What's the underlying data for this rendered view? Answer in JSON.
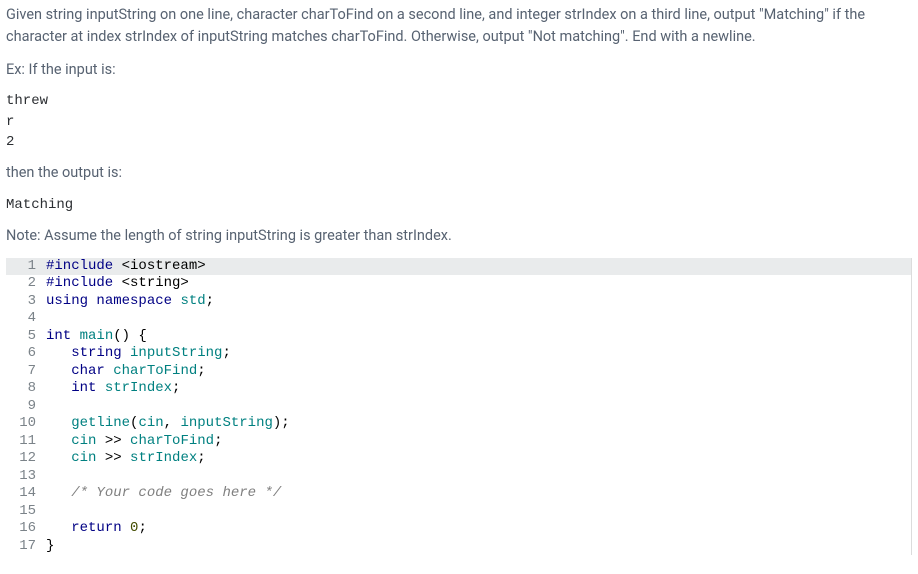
{
  "problem": {
    "description": "Given string inputString on one line, character charToFind on a second line, and integer strIndex on a third line, output \"Matching\" if the character at index strIndex of inputString matches charToFind. Otherwise, output \"Not matching\". End with a newline.",
    "example_intro": "Ex: If the input is:",
    "example_input_line1": "threw",
    "example_input_line2": "r",
    "example_input_line3": "2",
    "example_then": "then the output is:",
    "example_output": "Matching",
    "note": "Note: Assume the length of string inputString is greater than strIndex."
  },
  "code": {
    "lines": [
      {
        "n": 1,
        "tokens": [
          {
            "t": "#include ",
            "c": "kw"
          },
          {
            "t": "<iostream>",
            "c": "plain"
          }
        ],
        "current": true
      },
      {
        "n": 2,
        "tokens": [
          {
            "t": "#include ",
            "c": "kw"
          },
          {
            "t": "<string>",
            "c": "plain"
          }
        ]
      },
      {
        "n": 3,
        "tokens": [
          {
            "t": "using ",
            "c": "kw"
          },
          {
            "t": "namespace ",
            "c": "kw"
          },
          {
            "t": "std",
            "c": "ns"
          },
          {
            "t": ";",
            "c": "plain"
          }
        ]
      },
      {
        "n": 4,
        "tokens": []
      },
      {
        "n": 5,
        "tokens": [
          {
            "t": "int ",
            "c": "type"
          },
          {
            "t": "main",
            "c": "func"
          },
          {
            "t": "() {",
            "c": "plain"
          }
        ]
      },
      {
        "n": 6,
        "tokens": [
          {
            "t": "   ",
            "c": "plain"
          },
          {
            "t": "string ",
            "c": "type"
          },
          {
            "t": "inputString",
            "c": "ident"
          },
          {
            "t": ";",
            "c": "plain"
          }
        ]
      },
      {
        "n": 7,
        "tokens": [
          {
            "t": "   ",
            "c": "plain"
          },
          {
            "t": "char ",
            "c": "type"
          },
          {
            "t": "charToFind",
            "c": "ident"
          },
          {
            "t": ";",
            "c": "plain"
          }
        ]
      },
      {
        "n": 8,
        "tokens": [
          {
            "t": "   ",
            "c": "plain"
          },
          {
            "t": "int ",
            "c": "type"
          },
          {
            "t": "strIndex",
            "c": "ident"
          },
          {
            "t": ";",
            "c": "plain"
          }
        ]
      },
      {
        "n": 9,
        "tokens": []
      },
      {
        "n": 10,
        "tokens": [
          {
            "t": "   ",
            "c": "plain"
          },
          {
            "t": "getline",
            "c": "func"
          },
          {
            "t": "(",
            "c": "plain"
          },
          {
            "t": "cin",
            "c": "ident"
          },
          {
            "t": ", ",
            "c": "plain"
          },
          {
            "t": "inputString",
            "c": "ident"
          },
          {
            "t": ");",
            "c": "plain"
          }
        ]
      },
      {
        "n": 11,
        "tokens": [
          {
            "t": "   ",
            "c": "plain"
          },
          {
            "t": "cin",
            "c": "ident"
          },
          {
            "t": " >> ",
            "c": "plain"
          },
          {
            "t": "charToFind",
            "c": "ident"
          },
          {
            "t": ";",
            "c": "plain"
          }
        ]
      },
      {
        "n": 12,
        "tokens": [
          {
            "t": "   ",
            "c": "plain"
          },
          {
            "t": "cin",
            "c": "ident"
          },
          {
            "t": " >> ",
            "c": "plain"
          },
          {
            "t": "strIndex",
            "c": "ident"
          },
          {
            "t": ";",
            "c": "plain"
          }
        ]
      },
      {
        "n": 13,
        "tokens": []
      },
      {
        "n": 14,
        "tokens": [
          {
            "t": "   ",
            "c": "plain"
          },
          {
            "t": "/* Your code goes here */",
            "c": "comment"
          }
        ]
      },
      {
        "n": 15,
        "tokens": []
      },
      {
        "n": 16,
        "tokens": [
          {
            "t": "   ",
            "c": "plain"
          },
          {
            "t": "return ",
            "c": "kw"
          },
          {
            "t": "0",
            "c": "num"
          },
          {
            "t": ";",
            "c": "plain"
          }
        ]
      },
      {
        "n": 17,
        "tokens": [
          {
            "t": "}",
            "c": "plain"
          }
        ]
      }
    ]
  }
}
